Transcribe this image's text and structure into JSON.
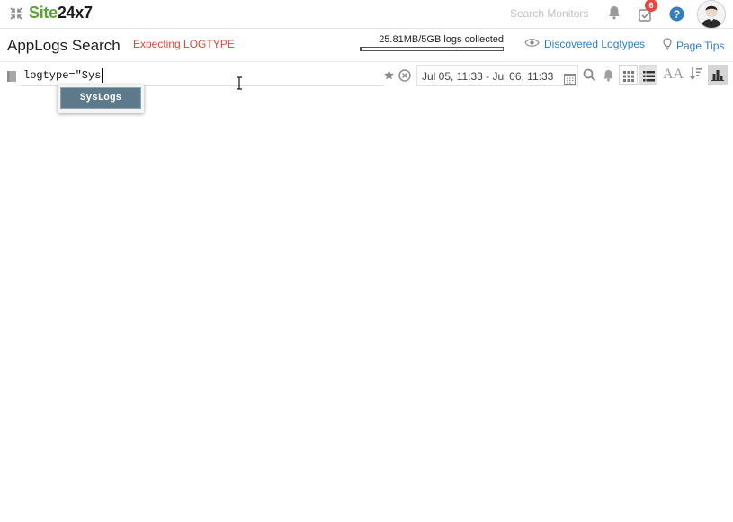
{
  "brand": {
    "name_part1": "Site",
    "name_part2": "24x7",
    "green": "#5aa531"
  },
  "topbar": {
    "search_placeholder": "Search Monitors",
    "notification_count": "6",
    "help_label": "?"
  },
  "header": {
    "title": "AppLogs Search",
    "status": "Expecting LOGTYPE",
    "usage_text": "25.81MB/5GB logs collected",
    "usage_fraction": 0.005,
    "discovered_label": "Discovered Logtypes",
    "page_tips_label": "Page Tips",
    "link_color": "#2f7dc4",
    "status_color": "#e0453a"
  },
  "query": {
    "value": "logtype=\"Sys",
    "date_range": "Jul 05, 11:33 - Jul 06, 11:33",
    "font_size_label": "AA"
  },
  "suggestions": [
    {
      "label": "SysLogs"
    }
  ],
  "icons": [
    "collapse-icon",
    "bell-icon",
    "tasks-icon",
    "help-icon",
    "avatar",
    "eye-icon",
    "bulb-icon",
    "book-icon",
    "star-icon",
    "clear-icon",
    "calendar-icon",
    "search-icon",
    "alert-icon",
    "grid-view-icon",
    "list-view-icon",
    "font-size-icon",
    "sort-icon",
    "chart-icon"
  ]
}
